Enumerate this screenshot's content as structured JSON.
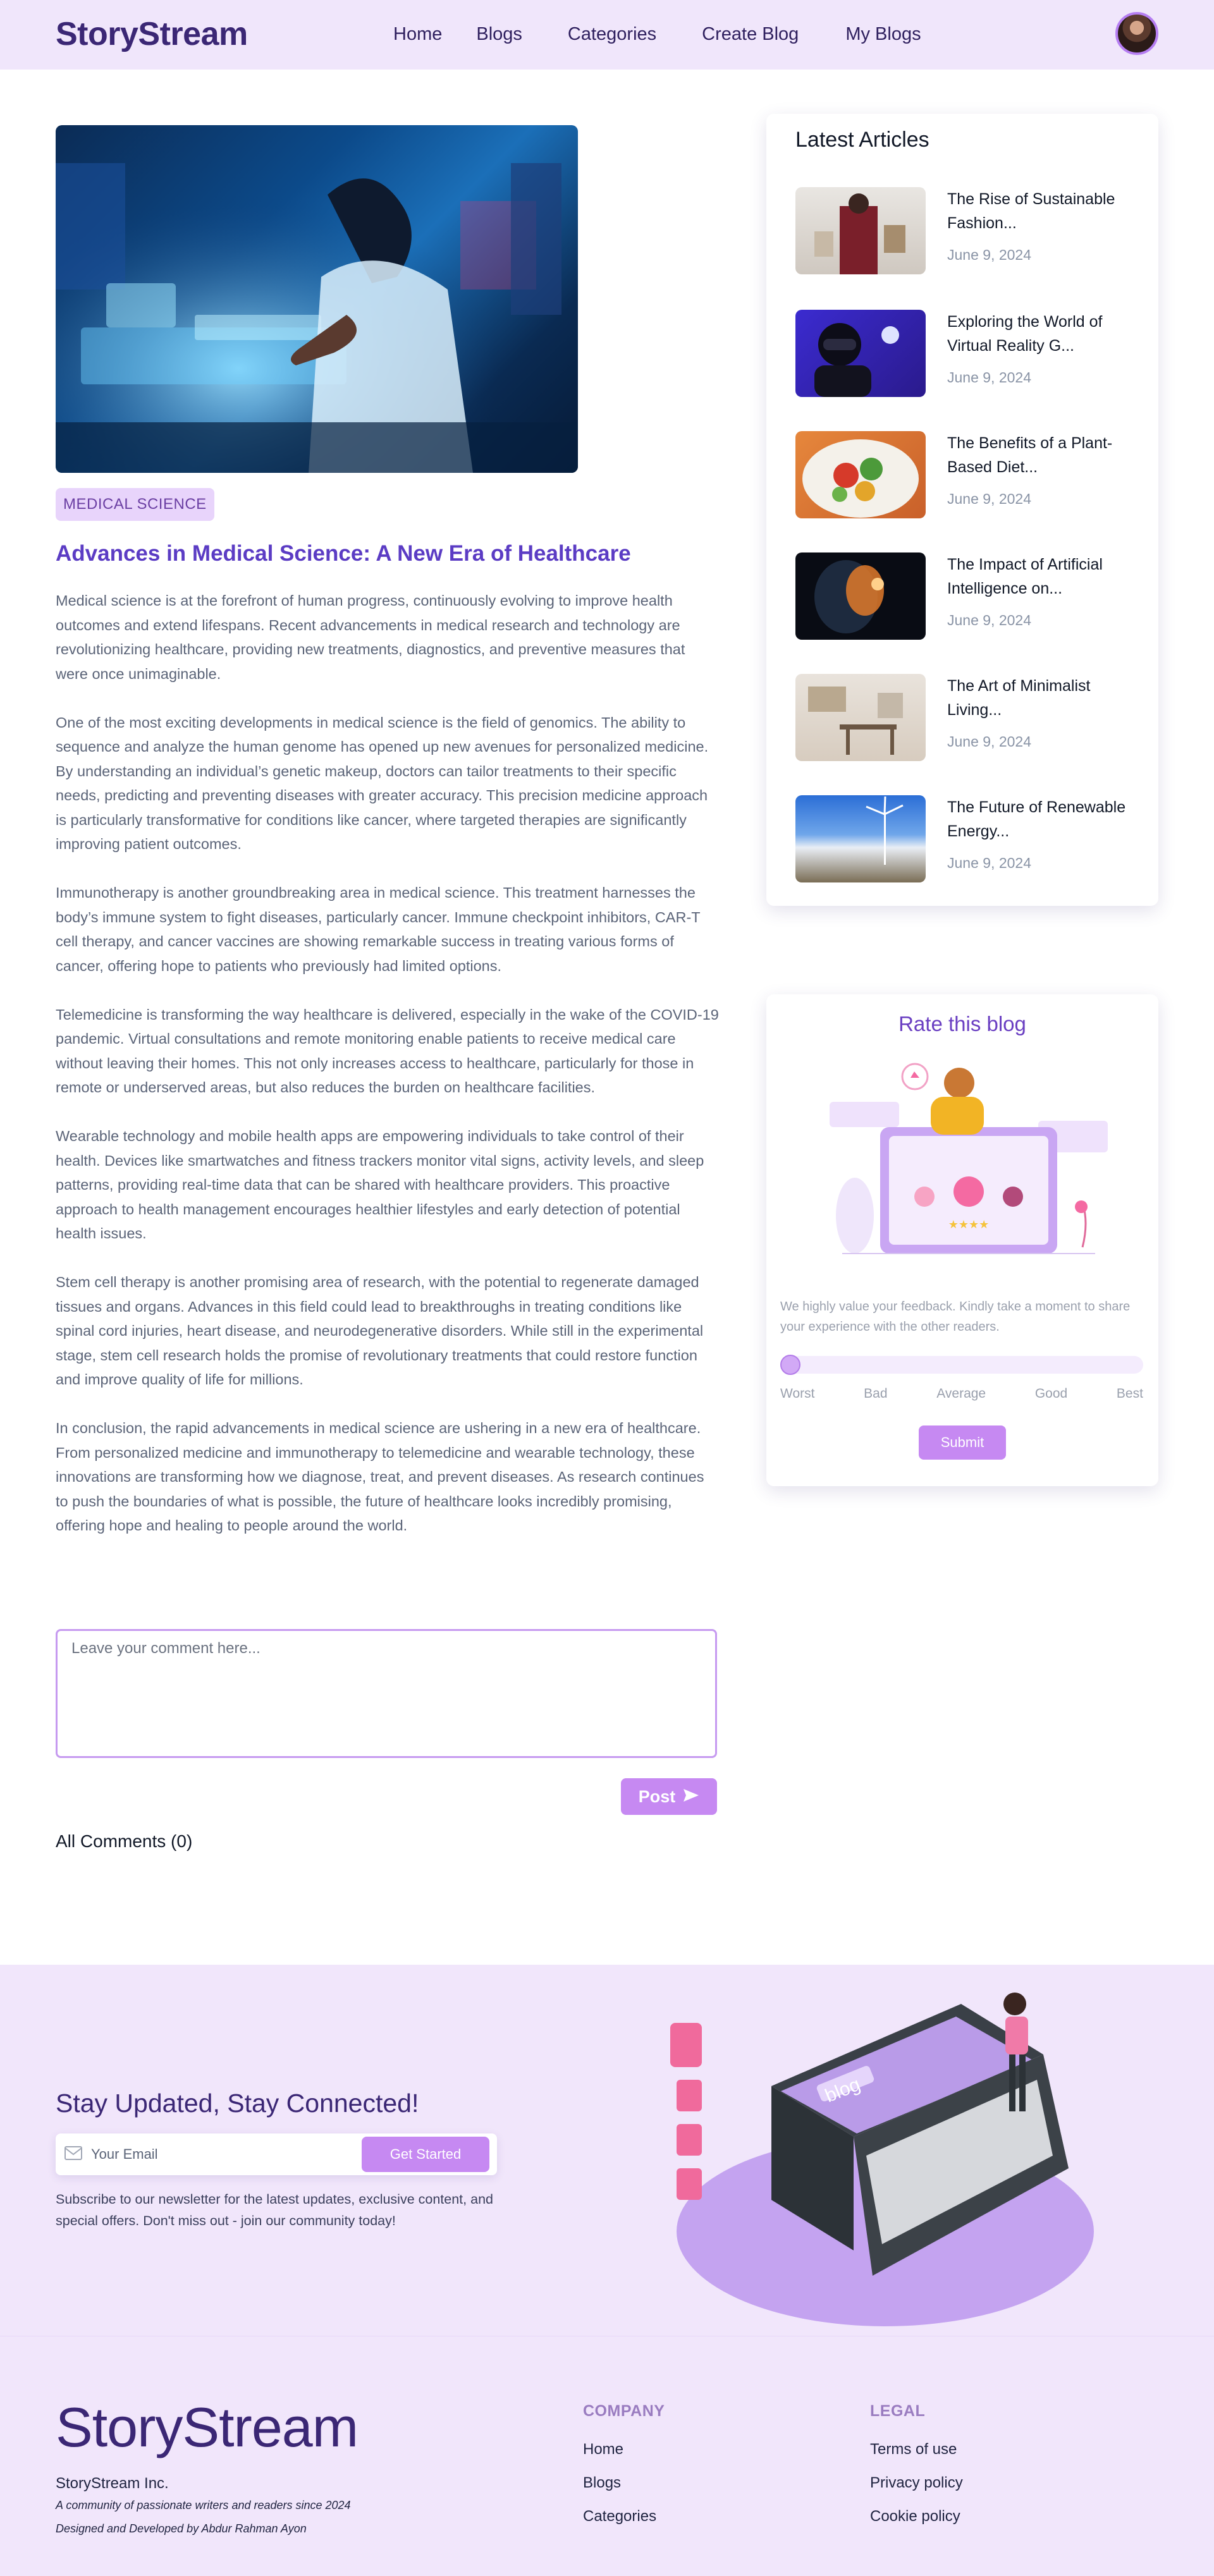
{
  "nav": {
    "brand": "StoryStream",
    "links": [
      "Home",
      "Blogs",
      "Categories",
      "Create Blog",
      "My Blogs"
    ]
  },
  "article": {
    "category": "MEDICAL SCIENCE",
    "title": "Advances in Medical Science: A New Era of Healthcare",
    "paragraphs": [
      "Medical science is at the forefront of human progress, continuously evolving to improve health outcomes and extend lifespans. Recent advancements in medical research and technology are revolutionizing healthcare, providing new treatments, diagnostics, and preventive measures that were once unimaginable.",
      "One of the most exciting developments in medical science is the field of genomics. The ability to sequence and analyze the human genome has opened up new avenues for personalized medicine. By understanding an individual’s genetic makeup, doctors can tailor treatments to their specific needs, predicting and preventing diseases with greater accuracy. This precision medicine approach is particularly transformative for conditions like cancer, where targeted therapies are significantly improving patient outcomes.",
      "Immunotherapy is another groundbreaking area in medical science. This treatment harnesses the body’s immune system to fight diseases, particularly cancer. Immune checkpoint inhibitors, CAR-T cell therapy, and cancer vaccines are showing remarkable success in treating various forms of cancer, offering hope to patients who previously had limited options.",
      "Telemedicine is transforming the way healthcare is delivered, especially in the wake of the COVID-19 pandemic. Virtual consultations and remote monitoring enable patients to receive medical care without leaving their homes. This not only increases access to healthcare, particularly for those in remote or underserved areas, but also reduces the burden on healthcare facilities.",
      "Wearable technology and mobile health apps are empowering individuals to take control of their health. Devices like smartwatches and fitness trackers monitor vital signs, activity levels, and sleep patterns, providing real-time data that can be shared with healthcare providers. This proactive approach to health management encourages healthier lifestyles and early detection of potential health issues.",
      "Stem cell therapy is another promising area of research, with the potential to regenerate damaged tissues and organs. Advances in this field could lead to breakthroughs in treating conditions like spinal cord injuries, heart disease, and neurodegenerative disorders. While still in the experimental stage, stem cell research holds the promise of revolutionary treatments that could restore function and improve quality of life for millions.",
      "In conclusion, the rapid advancements in medical science are ushering in a new era of healthcare. From personalized medicine and immunotherapy to telemedicine and wearable technology, these innovations are transforming how we diagnose, treat, and prevent diseases. As research continues to push the boundaries of what is possible, the future of healthcare looks incredibly promising, offering hope and healing to people around the world."
    ]
  },
  "comments": {
    "placeholder": "Leave your comment here...",
    "post_label": "Post",
    "all_comments_label": "All Comments (0)"
  },
  "latest": {
    "heading": "Latest Articles",
    "items": [
      {
        "title": "The Rise of Sustainable Fashion...",
        "date": "June 9, 2024"
      },
      {
        "title": "Exploring the World of Virtual Reality G...",
        "date": "June 9, 2024"
      },
      {
        "title": "The Benefits of a Plant-Based Diet...",
        "date": "June 9, 2024"
      },
      {
        "title": "The Impact of Artificial Intelligence on...",
        "date": "June 9, 2024"
      },
      {
        "title": "The Art of Minimalist Living...",
        "date": "June 9, 2024"
      },
      {
        "title": "The Future of Renewable Energy...",
        "date": "June 9, 2024"
      }
    ]
  },
  "rating": {
    "heading": "Rate this blog",
    "description": "We highly value your feedback. Kindly take a moment to share your experience with the other readers.",
    "labels": [
      "Worst",
      "Bad",
      "Average",
      "Good",
      "Best"
    ],
    "current_value": 0,
    "submit_label": "Submit"
  },
  "newsletter": {
    "title": "Stay Updated, Stay Connected!",
    "email_placeholder": "Your Email",
    "button_label": "Get Started",
    "subtitle": "Subscribe to our newsletter for the latest updates, exclusive content, and special offers. Don't miss out - join our community today!",
    "illustration_text": "blog"
  },
  "footer": {
    "brand": "StoryStream",
    "company_name": "StoryStream Inc.",
    "tagline": "A community of passionate writers and readers since 2024",
    "credit": "Designed and Developed by Abdur Rahman Ayon",
    "company_heading": "COMPANY",
    "company_links": [
      "Home",
      "Blogs",
      "Categories"
    ],
    "legal_heading": "LEGAL",
    "legal_links": [
      "Terms of use",
      "Privacy policy",
      "Cookie policy"
    ]
  },
  "colors": {
    "accent": "#c689f2",
    "brand": "#3b2775",
    "title": "#5b3cc4",
    "nav_bg": "#f0e6fb"
  }
}
